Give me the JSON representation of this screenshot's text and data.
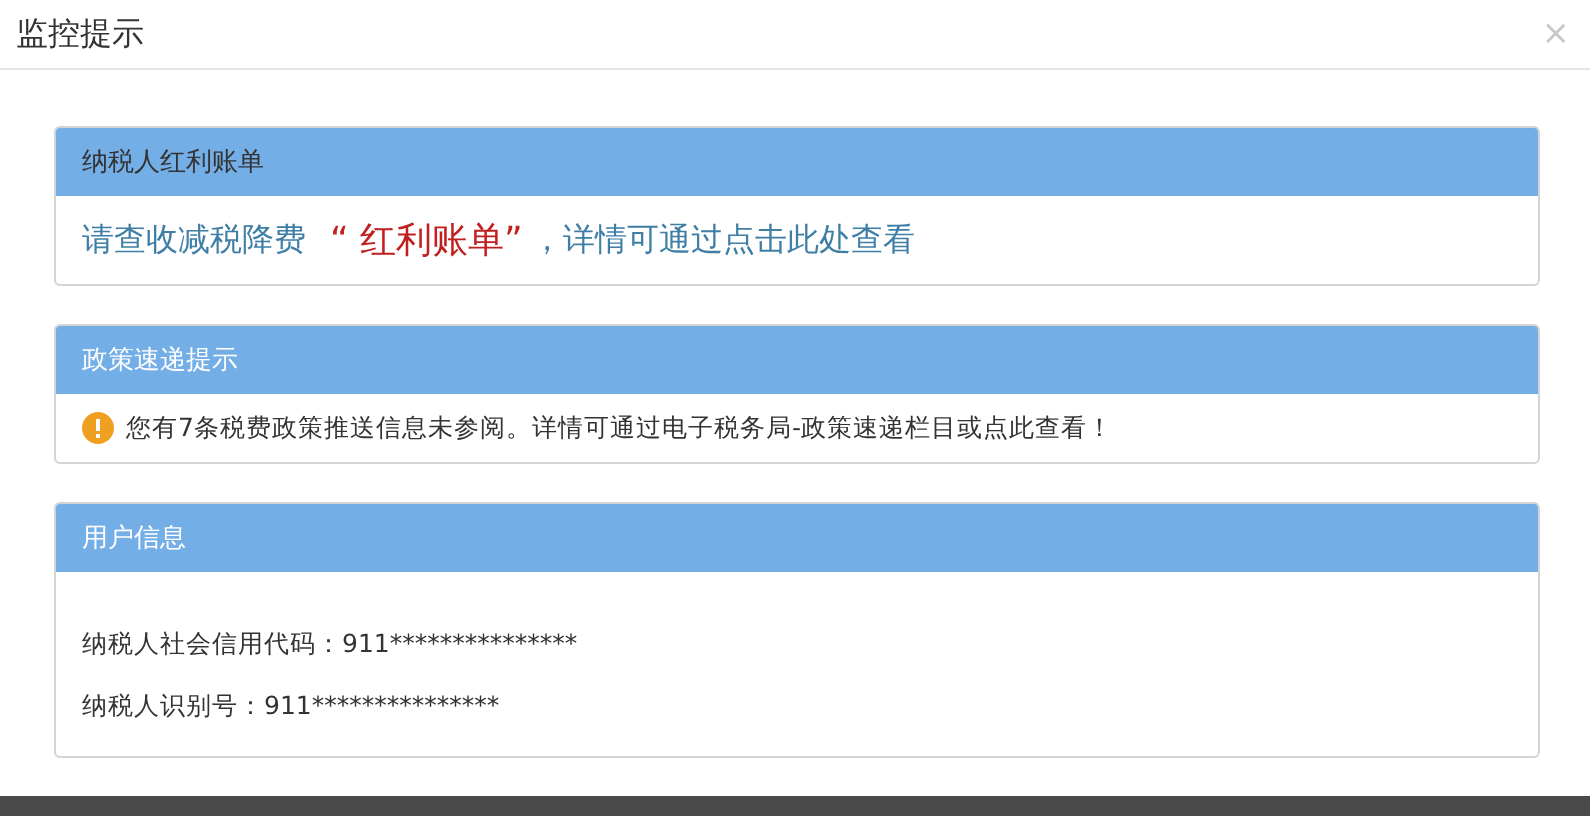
{
  "dialog": {
    "title": "监控提示",
    "close": "×"
  },
  "panels": [
    {
      "kind": "bill",
      "header": "纳税人红利账单",
      "prefix": "请查收减税降费",
      "highlight": "“ 红利账单”",
      "suffix": "，详情可通过点击此处查看"
    },
    {
      "kind": "notice",
      "header": "政策速递提示",
      "text": "您有7条税费政策推送信息未参阅。详情可通过电子税务局-政策速递栏目或点此查看！"
    },
    {
      "kind": "info",
      "header": "用户信息",
      "lines": [
        "纳税人社会信用代码：911***************",
        "纳税人识别号：911***************"
      ]
    }
  ]
}
